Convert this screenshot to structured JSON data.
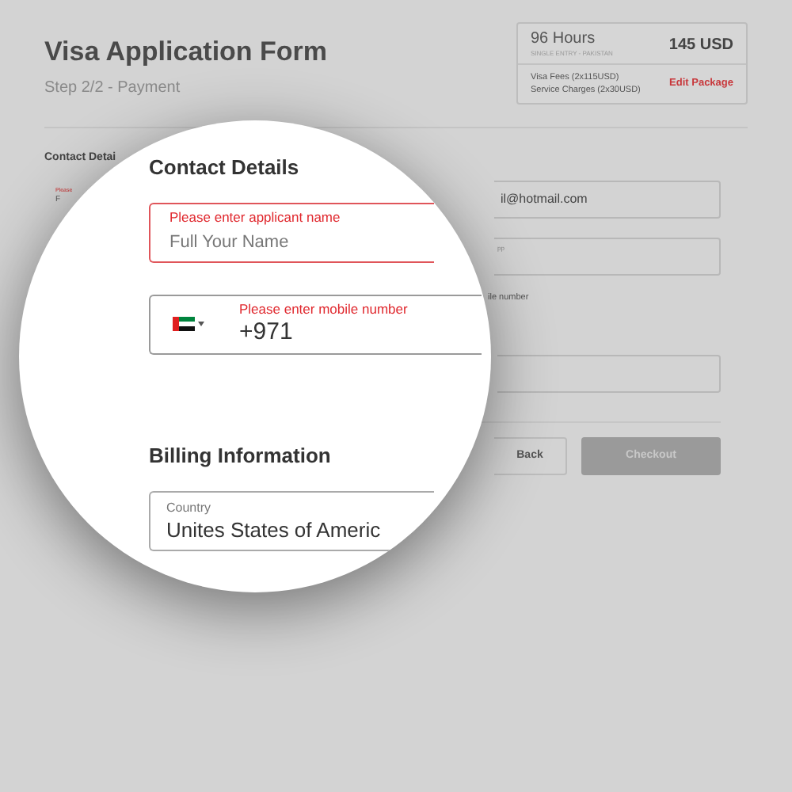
{
  "header": {
    "title": "Visa Application Form",
    "step": "Step 2/2 - Payment"
  },
  "package": {
    "duration": "96 Hours",
    "entry": "SINGLE ENTRY - PAKISTAN",
    "price": "145 USD",
    "fees": [
      "Visa Fees (2x115USD)",
      "Service Charges (2x30USD)"
    ],
    "edit_link": "Edit Package"
  },
  "background_form": {
    "section": "Contact Detai",
    "name_field": {
      "label": "Please",
      "value": "F"
    },
    "email_value": "il@hotmail.com",
    "second_label": "pp",
    "hint": "ile number",
    "back_button": "Back",
    "checkout_button": {
      "label": "Checkout",
      "disabled": true
    }
  },
  "magnifier": {
    "contact_title": "Contact Details",
    "fields": [
      {
        "kind": "text",
        "label": "Please enter applicant name",
        "placeholder": "Full Your Name",
        "error": true,
        "highlighted": true
      },
      {
        "kind": "phone",
        "label": "Please enter mobile number",
        "value": "+971",
        "error": true,
        "highlighted": false
      }
    ],
    "billing_title": "Billing Information",
    "country_field": {
      "label": "Country",
      "value": "Unites States of Americ"
    }
  }
}
